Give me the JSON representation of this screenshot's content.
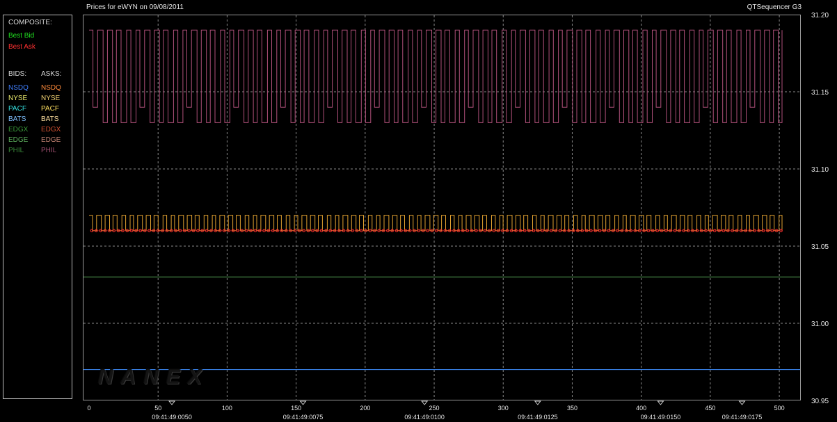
{
  "title": "Prices for  eWYN  on  09/08/2011",
  "app_name": "QTSequencer G3",
  "watermark": "NANEX",
  "legend": {
    "composite_header": "COMPOSITE:",
    "best_bid": "Best Bid",
    "best_ask": "Best Ask",
    "bids_header": "BIDS:",
    "asks_header": "ASKS:",
    "exchanges": [
      "NSDQ",
      "NYSE",
      "PACF",
      "BATS",
      "EDGX",
      "EDGE",
      "PHIL"
    ],
    "bid_colors": [
      "#3f7fff",
      "#f0f070",
      "#35e0e0",
      "#7fc0ff",
      "#3a9a3a",
      "#5aaa5a",
      "#3a8a3a"
    ],
    "ask_colors": [
      "#ff8a3a",
      "#f0d070",
      "#ffe060",
      "#ffe0a0",
      "#d05030",
      "#c08070",
      "#a05070"
    ],
    "best_bid_color": "#20e020",
    "best_ask_color": "#ff3030"
  },
  "chart_data": {
    "type": "line",
    "title": "Prices for  eWYN  on  09/08/2011",
    "x_ticks": [
      0,
      50,
      100,
      150,
      200,
      250,
      300,
      350,
      400,
      450,
      500
    ],
    "x_range": [
      0,
      505
    ],
    "y_ticks": [
      "31.20",
      "31.15",
      "31.10",
      "31.05",
      "31.00",
      "30.95"
    ],
    "y_range": [
      30.95,
      31.2
    ],
    "time_labels": [
      {
        "x": 60,
        "label": "09:41:49:0050"
      },
      {
        "x": 155,
        "label": "09:41:49:0075"
      },
      {
        "x": 243,
        "label": "09:41:49:0100"
      },
      {
        "x": 325,
        "label": "09:41:49:0125"
      },
      {
        "x": 414,
        "label": "09:41:49:0150"
      },
      {
        "x": 473,
        "label": "09:41:49:0175"
      }
    ],
    "grid": true,
    "series": [
      {
        "name": "PHIL",
        "color": "#b0507a",
        "kind": "oscillating",
        "high": 31.19,
        "low": 31.13,
        "mid": 31.14,
        "period": 4
      },
      {
        "name": "NYSE",
        "color": "#e0a030",
        "kind": "oscillating",
        "high": 31.07,
        "low": 31.06,
        "period": 3.5
      },
      {
        "name": "Best Ask",
        "color": "#ff3030",
        "kind": "markers",
        "value": 31.06,
        "step": 3.2
      },
      {
        "name": "EDGE",
        "color": "#5aaa5a",
        "kind": "flat",
        "value": 31.03
      },
      {
        "name": "NSDQ",
        "color": "#3f8fff",
        "kind": "flat",
        "value": 30.97
      }
    ]
  }
}
